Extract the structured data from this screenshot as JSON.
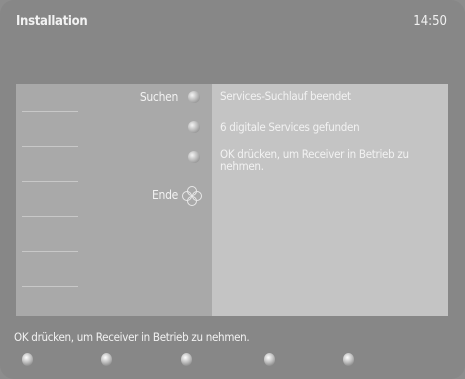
{
  "header": {
    "title": "Installation",
    "time": "14:50"
  },
  "menu": {
    "search_label": "Suchen",
    "end_label": "Ende"
  },
  "messages": {
    "line1": "Services-Suchlauf beendet",
    "line2": "6 digitale Services gefunden",
    "line3": "OK drücken, um Receiver in Betrieb zu nehmen."
  },
  "status_text": "OK drücken, um Receiver in Betrieb zu nehmen.",
  "icons": [
    "button-indicator-icon",
    "navigation-pad-icon",
    "remote-button-icon"
  ]
}
